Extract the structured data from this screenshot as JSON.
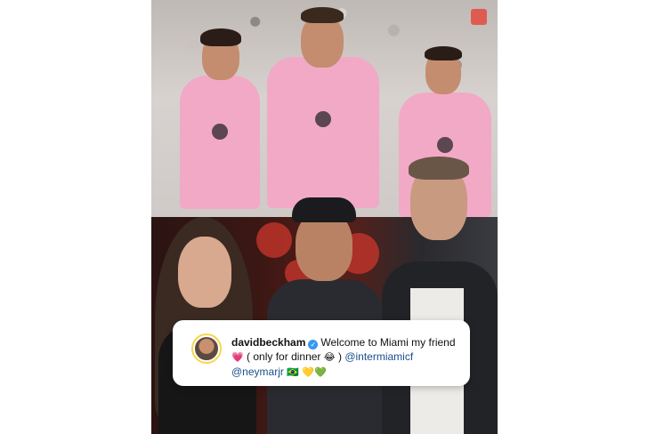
{
  "post": {
    "caption": {
      "username": "davidbeckham",
      "message": "Welcome to Miami my friend",
      "line2_emoji_heart": "💗",
      "line2_text": "( only for dinner",
      "line2_emoji_laugh": "😂",
      "line2_close": ")",
      "mention_club": "@intermiamicf",
      "mention_player": "@neymarjr",
      "trailing_emojis": "🇧🇷 💛💚"
    },
    "colors": {
      "jersey_pink": "#f2a9c6",
      "verified_blue": "#3897f0"
    }
  }
}
